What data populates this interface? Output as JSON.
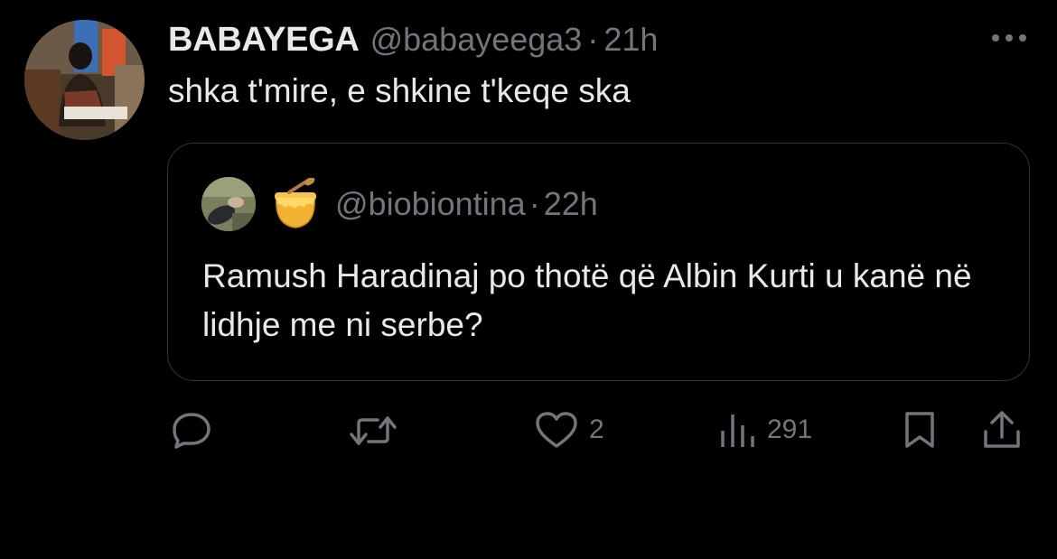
{
  "tweet": {
    "display_name": "BABAYEGA",
    "handle": "@babayeega3",
    "separator": "·",
    "time": "21h",
    "text": "shka t'mire, e shkine t'keqe ska"
  },
  "quoted_tweet": {
    "handle": "@biobiontina",
    "separator": "·",
    "time": "22h",
    "emoji_icon": "honey-pot-icon",
    "text": "Ramush Haradinaj po thotë që Albin Kurti u kanë në lidhje me ni serbe?"
  },
  "actions": {
    "likes": "2",
    "views": "291"
  },
  "colors": {
    "background": "#000000",
    "text_primary": "#e7e9ea",
    "text_secondary": "#71767b",
    "border": "#2f3336"
  }
}
